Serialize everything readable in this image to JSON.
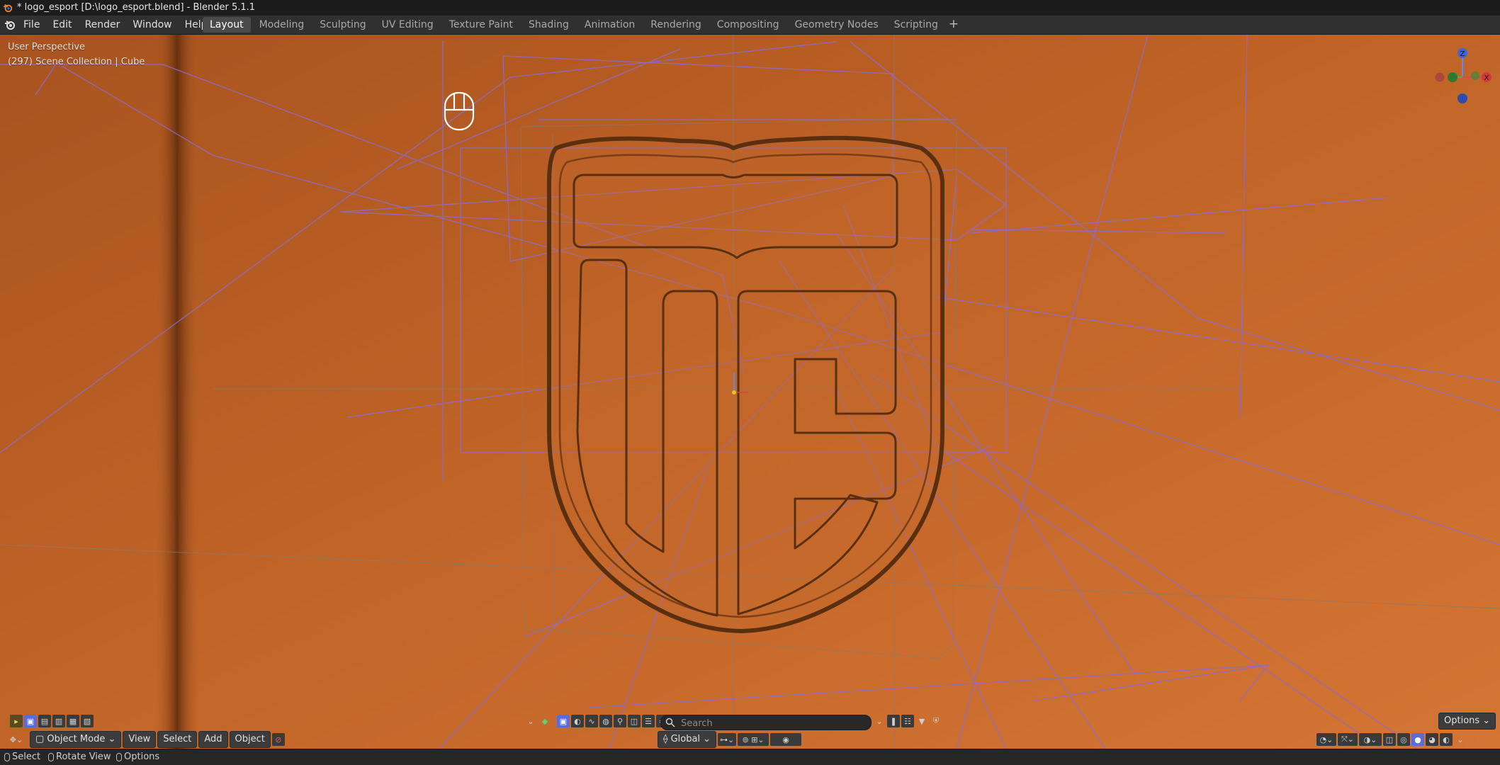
{
  "window": {
    "title": "* logo_esport [D:\\logo_esport.blend] - Blender 5.1.1"
  },
  "menu": [
    "File",
    "Edit",
    "Render",
    "Window",
    "Help"
  ],
  "workspaces": {
    "tabs": [
      "Layout",
      "Modeling",
      "Sculpting",
      "UV Editing",
      "Texture Paint",
      "Shading",
      "Animation",
      "Rendering",
      "Compositing",
      "Geometry Nodes",
      "Scripting"
    ],
    "active": "Layout",
    "add_label": "+"
  },
  "viewport": {
    "perspective": "User Perspective",
    "collection_info": "(297) Scene Collection | Cube",
    "background_color": "#c8692a",
    "gizmo": {
      "x": "X",
      "z": "Z"
    }
  },
  "header": {
    "mode": "Object Mode",
    "view": "View",
    "select": "Select",
    "add": "Add",
    "object": "Object",
    "transform_orientation": "Global",
    "options": "Options",
    "search_placeholder": "Search"
  },
  "status": {
    "select": "Select",
    "rotate": "Rotate View",
    "options": "Options"
  },
  "icons": [
    "blender-icon",
    "mouse-icon",
    "search-icon",
    "filter-icon",
    "bookmark-icon",
    "shield-icon",
    "chevron-down-icon"
  ],
  "colors": {
    "accent": "#5b6cd8",
    "wire": "#8c6cd4",
    "logo_stroke": "#5a2f10"
  }
}
